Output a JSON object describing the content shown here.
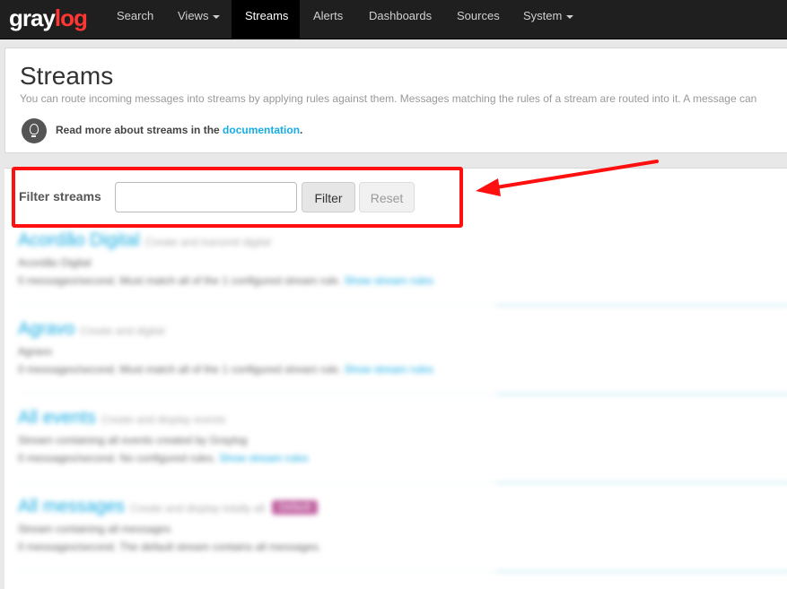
{
  "navbar": {
    "logo_gray": "gray",
    "logo_log": "log",
    "items": [
      {
        "label": "Search"
      },
      {
        "label": "Views"
      },
      {
        "label": "Streams"
      },
      {
        "label": "Alerts"
      },
      {
        "label": "Dashboards"
      },
      {
        "label": "Sources"
      },
      {
        "label": "System"
      }
    ],
    "active": "Streams"
  },
  "header": {
    "title": "Streams",
    "description": "You can route incoming messages into streams by applying rules against them. Messages matching the rules of a stream are routed into it. A message can",
    "read_more_prefix": "Read more about streams in the ",
    "read_more_link": "documentation",
    "read_more_suffix": "."
  },
  "filter": {
    "label": "Filter streams",
    "input_value": "",
    "filter_button": "Filter",
    "reset_button": "Reset"
  },
  "streams": [
    {
      "title": "Acordão Digital",
      "subtitle": "Create and transmit digital",
      "line1": "Acordão Digital",
      "line2": "0 messages/second. Must match all of the 1 configured stream rule.",
      "link": "Show stream rules"
    },
    {
      "title": "Agravo",
      "subtitle": "Create and digital",
      "line1": "Agravo",
      "line2": "0 messages/second. Must match all of the 1 configured stream rule.",
      "link": "Show stream rules"
    },
    {
      "title": "All events",
      "subtitle": "Create and display events",
      "line1": "Stream containing all events created by Graylog",
      "line2": "0 messages/second. No configured rules.",
      "link": "Show stream rules"
    },
    {
      "title": "All messages",
      "subtitle": "Create and display totally all",
      "badge": "Default",
      "line1": "Stream containing all messages",
      "line2": "0 messages/second. The default stream contains all messages."
    }
  ],
  "colors": {
    "navbar_bg": "#1f1f1f",
    "accent": "#16ace3",
    "logo_red": "#ff3633",
    "highlight": "#ff1010"
  }
}
